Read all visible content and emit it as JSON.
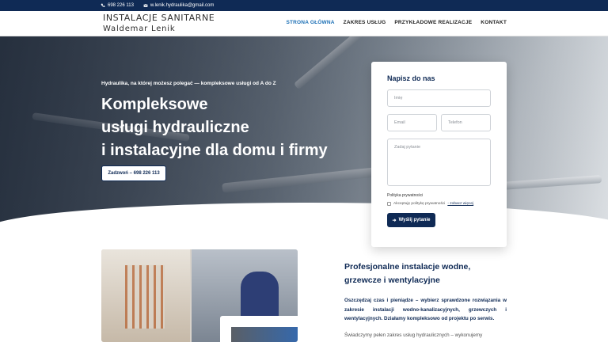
{
  "topbar": {
    "phone": "698 226 113",
    "email": "w.lenik.hydraulika@gmail.com"
  },
  "logo": {
    "line1": "INSTALACJE SANITARNE",
    "line2": "Waldemar Lenik"
  },
  "nav": [
    {
      "label": "STRONA GŁÓWNA"
    },
    {
      "label": "ZAKRES USŁUG"
    },
    {
      "label": "PRZYKŁADOWE REALIZACJE"
    },
    {
      "label": "KONTAKT"
    }
  ],
  "hero": {
    "tagline": "Hydraulika, na której możesz polegać — kompleksowe usługi od A do Z",
    "title_line1": "Kompleksowe",
    "title_line2": "usługi hydrauliczne",
    "title_line3": "i instalacyjne dla domu i firmy",
    "cta": "Zadzwoń – 698 226 113"
  },
  "form": {
    "title": "Napisz do nas",
    "name_placeholder": "Imię",
    "email_placeholder": "Email",
    "phone_placeholder": "Telefon",
    "question_placeholder": "Zadaj pytanie",
    "policy_title": "Polityka prywatności",
    "policy_text": "Akceptuję politykę prywatności",
    "policy_link": "- zobacz więcej",
    "send": "Wyślij pytanie"
  },
  "section": {
    "heading_line1": "Profesjonalne instalacje wodne,",
    "heading_line2": "grzewcze i wentylacyjne",
    "paragraph1": "Oszczędzaj czas i pieniądze – wybierz sprawdzone rozwiązania w zakresie instalacji wodno-kanalizacyjnych, grzewczych i wentylacyjnych. Działamy kompleksowo od projektu po serwis.",
    "paragraph2": "Świadczymy pełen zakres usług hydraulicznych – wykonujemy"
  },
  "colors": {
    "navy": "#0f2a55",
    "active_nav": "#1b6fb5"
  }
}
